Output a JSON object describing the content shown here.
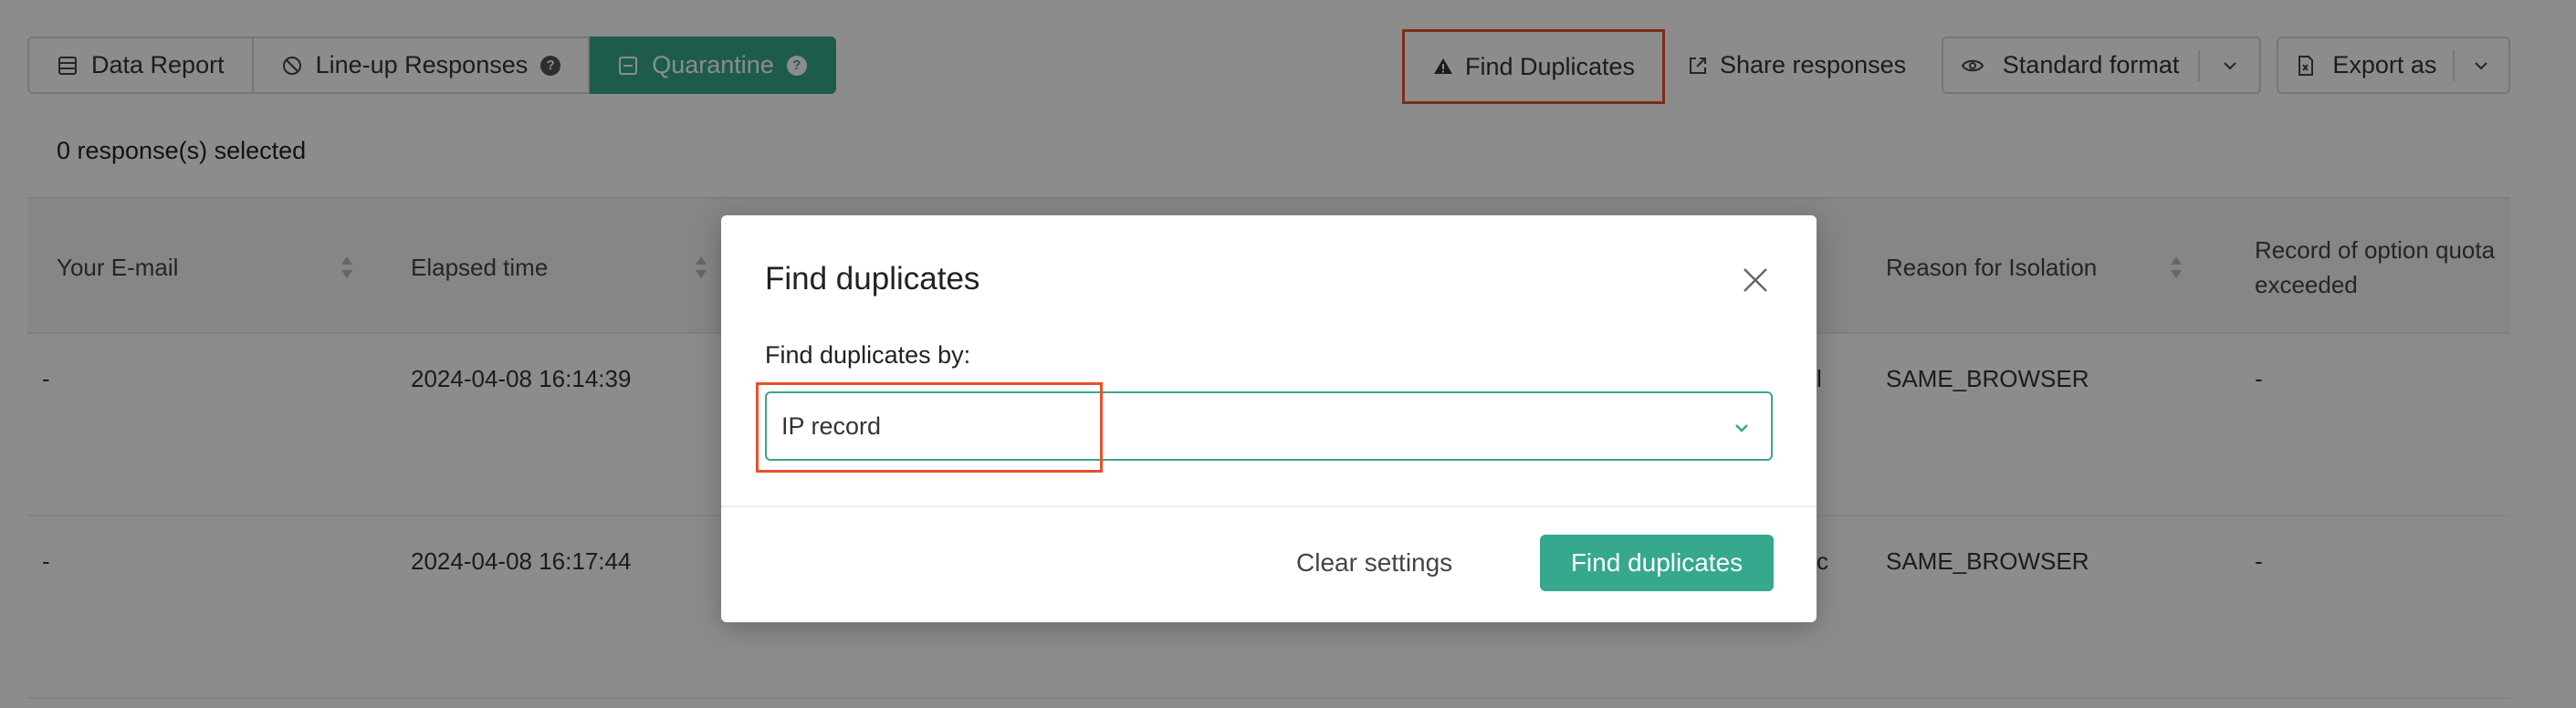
{
  "tabs": [
    {
      "label": "Data Report",
      "icon": "list-icon"
    },
    {
      "label": "Line-up Responses",
      "icon": "ban-icon"
    },
    {
      "label": "Quarantine",
      "icon": "minus-box-icon"
    }
  ],
  "toolbar": {
    "find_duplicates": "Find Duplicates",
    "share_responses": "Share responses",
    "standard_format": "Standard format",
    "export_as": "Export as"
  },
  "selection": {
    "count_text": "0 response(s) selected"
  },
  "table": {
    "columns": [
      "Your E-mail",
      "Elapsed time",
      "Reason for Isolation",
      "Record of option quota exceeded"
    ],
    "rows": [
      {
        "email": "-",
        "elapsed": "2024-04-08 16:14:39",
        "partial": "l",
        "reason": "SAME_BROWSER",
        "quota": "-"
      },
      {
        "email": "-",
        "elapsed": "2024-04-08 16:17:44",
        "partial": "c",
        "reason": "SAME_BROWSER",
        "quota": "-"
      }
    ]
  },
  "modal": {
    "title": "Find duplicates",
    "field_label": "Find duplicates by:",
    "selected_value": "IP record",
    "clear_button": "Clear settings",
    "submit_button": "Find duplicates"
  },
  "colors": {
    "accent": "#35a88d",
    "highlight": "#e8502a"
  }
}
